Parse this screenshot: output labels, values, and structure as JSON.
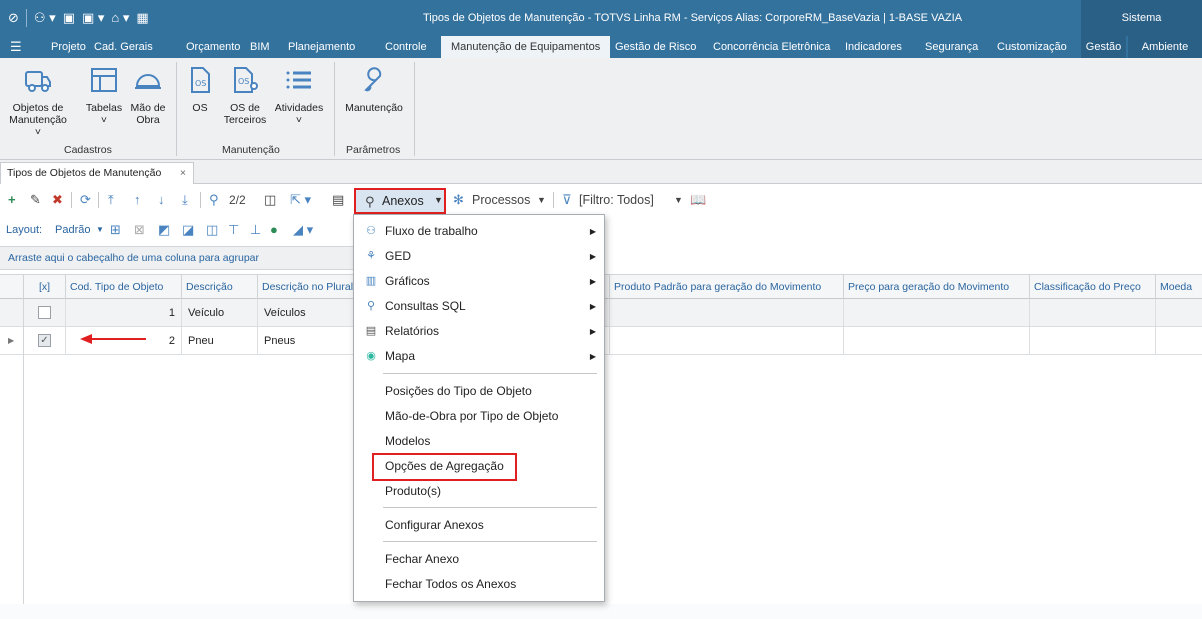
{
  "titlebar": {
    "title": "Tipos de Objetos de Manutenção - TOTVS Linha RM - Serviços  Alias: CorporeRM_BaseVazia | 1-BASE VAZIA",
    "system": "Sistema"
  },
  "menubar": {
    "items": [
      "Projeto",
      "Cad. Gerais",
      "Orçamento",
      "BIM",
      "Planejamento",
      "Controle",
      "Manutenção de Equipamentos",
      "Gestão de Risco",
      "Concorrência Eletrônica",
      "Indicadores",
      "Segurança",
      "Customização",
      "Gestão",
      "Ambiente"
    ]
  },
  "ribbon": {
    "buttons": {
      "objetos": "Objetos de Manutenção",
      "tabelas": "Tabelas",
      "maodeobra": "Mão de Obra",
      "os": "OS",
      "osterceiros": "OS de Terceiros",
      "atividades": "Atividades",
      "manutencao": "Manutenção"
    },
    "groups": {
      "cadastros": "Cadastros",
      "manutencao": "Manutenção",
      "parametros": "Parâmetros"
    }
  },
  "doctab": {
    "label": "Tipos de Objetos de Manutenção",
    "close": "×"
  },
  "toolbar": {
    "page": "2/2",
    "anexos": "Anexos",
    "processos": "Processos",
    "filtro": "[Filtro: Todos]",
    "layout_label": "Layout:",
    "layout_value": "Padrão"
  },
  "grouping_hint": "Arraste aqui o cabeçalho de uma coluna para agrupar",
  "grid": {
    "columns": [
      "[x]",
      "Cod. Tipo de Objeto",
      "Descrição",
      "Descrição no Plural",
      "Produto Padrão para geração do Movimento",
      "Preço para geração do Movimento",
      "Classificação do Preço",
      "Moeda"
    ],
    "rows": [
      {
        "code": "1",
        "descricao": "Veículo",
        "plural": "Veículos",
        "checked": false
      },
      {
        "code": "2",
        "descricao": "Pneu",
        "plural": "Pneus",
        "checked": true
      }
    ]
  },
  "dropdown": {
    "submenus": [
      {
        "label": "Fluxo de trabalho",
        "icon": "workflow-icon"
      },
      {
        "label": "GED",
        "icon": "ged-icon"
      },
      {
        "label": "Gráficos",
        "icon": "chart-icon"
      },
      {
        "label": "Consultas SQL",
        "icon": "search-icon"
      },
      {
        "label": "Relatórios",
        "icon": "report-icon"
      },
      {
        "label": "Mapa",
        "icon": "map-pin-icon"
      }
    ],
    "items": [
      "Posições do Tipo de Objeto",
      "Mão-de-Obra por Tipo de Objeto",
      "Modelos",
      "Opções de Agregação",
      "Produto(s)"
    ],
    "configurar": "Configurar Anexos",
    "fechar": "Fechar Anexo",
    "fechar_todos": "Fechar Todos os Anexos"
  },
  "colors": {
    "titlebar": "#34729e",
    "highlight": "#e02020",
    "accent": "#2a65a0"
  }
}
